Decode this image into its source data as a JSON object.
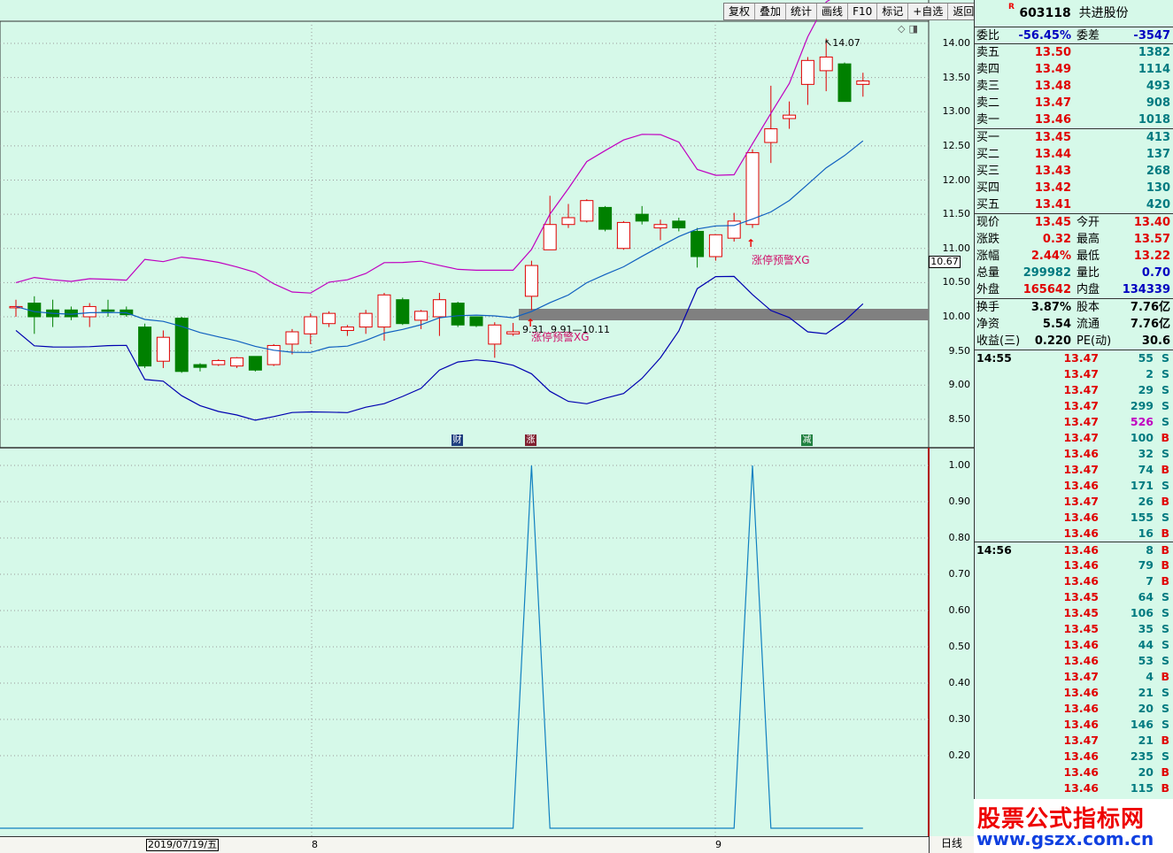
{
  "toolbar": [
    "复权",
    "叠加",
    "统计",
    "画线",
    "F10",
    "标记",
    "+自选",
    "返回"
  ],
  "chart": {
    "main_yticks": [
      "14.00",
      "13.50",
      "13.00",
      "12.50",
      "12.00",
      "11.50",
      "11.00",
      "10.50",
      "10.00",
      "9.50",
      "9.00",
      "8.50"
    ],
    "indicator_yticks": [
      "1.00",
      "0.90",
      "0.80",
      "0.70",
      "0.60",
      "0.50",
      "0.40",
      "0.30",
      "0.20"
    ],
    "current_price_tag": "10.67",
    "high_label": "14.07",
    "low_label": "9.31",
    "range_label": "9.91—10.11",
    "signal_label": "涨停预警XG",
    "event_marks": [
      {
        "text": "财",
        "color": "#204080"
      },
      {
        "text": "涨",
        "color": "#802030"
      },
      {
        "text": "减",
        "color": "#208040"
      }
    ],
    "dates": [
      "2019/07/19/五",
      "8",
      "9"
    ],
    "period": "日线",
    "candles": [
      {
        "o": 10.15,
        "h": 10.25,
        "l": 10.0,
        "c": 10.15
      },
      {
        "o": 10.2,
        "h": 10.3,
        "l": 9.75,
        "c": 10.0
      },
      {
        "o": 10.1,
        "h": 10.25,
        "l": 9.85,
        "c": 10.0
      },
      {
        "o": 10.1,
        "h": 10.15,
        "l": 9.95,
        "c": 10.0
      },
      {
        "o": 10.0,
        "h": 10.2,
        "l": 9.85,
        "c": 10.15
      },
      {
        "o": 10.1,
        "h": 10.25,
        "l": 10.0,
        "c": 10.08
      },
      {
        "o": 10.1,
        "h": 10.15,
        "l": 10.0,
        "c": 10.03
      },
      {
        "o": 9.85,
        "h": 9.9,
        "l": 9.25,
        "c": 9.28
      },
      {
        "o": 9.35,
        "h": 9.8,
        "l": 9.25,
        "c": 9.7
      },
      {
        "o": 9.98,
        "h": 10.0,
        "l": 9.18,
        "c": 9.2
      },
      {
        "o": 9.3,
        "h": 9.32,
        "l": 9.2,
        "c": 9.26
      },
      {
        "o": 9.3,
        "h": 9.38,
        "l": 9.28,
        "c": 9.36
      },
      {
        "o": 9.28,
        "h": 9.41,
        "l": 9.25,
        "c": 9.4
      },
      {
        "o": 9.42,
        "h": 9.42,
        "l": 9.2,
        "c": 9.22
      },
      {
        "o": 9.3,
        "h": 9.6,
        "l": 9.28,
        "c": 9.58
      },
      {
        "o": 9.6,
        "h": 9.82,
        "l": 9.45,
        "c": 9.78
      },
      {
        "o": 9.75,
        "h": 10.05,
        "l": 9.6,
        "c": 10.0
      },
      {
        "o": 9.9,
        "h": 10.08,
        "l": 9.85,
        "c": 10.05
      },
      {
        "o": 9.8,
        "h": 9.88,
        "l": 9.72,
        "c": 9.85
      },
      {
        "o": 9.85,
        "h": 10.1,
        "l": 9.75,
        "c": 10.05
      },
      {
        "o": 9.85,
        "h": 10.35,
        "l": 9.65,
        "c": 10.32
      },
      {
        "o": 10.25,
        "h": 10.28,
        "l": 9.88,
        "c": 9.9
      },
      {
        "o": 9.95,
        "h": 10.1,
        "l": 9.82,
        "c": 10.08
      },
      {
        "o": 10.0,
        "h": 10.35,
        "l": 9.72,
        "c": 10.25
      },
      {
        "o": 10.2,
        "h": 10.22,
        "l": 9.85,
        "c": 9.88
      },
      {
        "o": 10.0,
        "h": 10.0,
        "l": 9.85,
        "c": 9.87
      },
      {
        "o": 9.6,
        "h": 9.92,
        "l": 9.4,
        "c": 9.88
      },
      {
        "o": 9.75,
        "h": 9.91,
        "l": 9.72,
        "c": 9.78
      },
      {
        "o": 10.3,
        "h": 10.82,
        "l": 10.1,
        "c": 10.75
      },
      {
        "o": 10.98,
        "h": 11.77,
        "l": 10.98,
        "c": 11.35
      },
      {
        "o": 11.35,
        "h": 11.65,
        "l": 11.3,
        "c": 11.45
      },
      {
        "o": 11.4,
        "h": 11.72,
        "l": 11.38,
        "c": 11.7
      },
      {
        "o": 11.6,
        "h": 11.62,
        "l": 11.25,
        "c": 11.28
      },
      {
        "o": 11.0,
        "h": 11.4,
        "l": 10.98,
        "c": 11.38
      },
      {
        "o": 11.5,
        "h": 11.62,
        "l": 11.35,
        "c": 11.4
      },
      {
        "o": 11.3,
        "h": 11.42,
        "l": 11.12,
        "c": 11.35
      },
      {
        "o": 11.4,
        "h": 11.45,
        "l": 11.25,
        "c": 11.3
      },
      {
        "o": 11.25,
        "h": 11.3,
        "l": 10.72,
        "c": 10.88
      },
      {
        "o": 10.88,
        "h": 11.2,
        "l": 10.82,
        "c": 11.2
      },
      {
        "o": 11.15,
        "h": 11.52,
        "l": 11.1,
        "c": 11.4
      },
      {
        "o": 11.35,
        "h": 12.45,
        "l": 11.3,
        "c": 12.4
      },
      {
        "o": 12.55,
        "h": 13.38,
        "l": 12.25,
        "c": 12.75
      },
      {
        "o": 12.9,
        "h": 13.15,
        "l": 12.75,
        "c": 12.95
      },
      {
        "o": 13.4,
        "h": 13.8,
        "l": 13.1,
        "c": 13.75
      },
      {
        "o": 13.6,
        "h": 14.07,
        "l": 13.3,
        "c": 13.8
      },
      {
        "o": 13.7,
        "h": 13.72,
        "l": 13.15,
        "c": 13.15
      },
      {
        "o": 13.4,
        "h": 13.57,
        "l": 13.22,
        "c": 13.45
      }
    ]
  },
  "panel": {
    "code": "603118",
    "name": "共进股份",
    "r_mark": "R",
    "weibi": {
      "label": "委比",
      "value": "-56.45%",
      "label2": "委差",
      "value2": "-3547"
    },
    "sells": [
      {
        "label": "卖五",
        "price": "13.50",
        "vol": "1382"
      },
      {
        "label": "卖四",
        "price": "13.49",
        "vol": "1114"
      },
      {
        "label": "卖三",
        "price": "13.48",
        "vol": "493"
      },
      {
        "label": "卖二",
        "price": "13.47",
        "vol": "908"
      },
      {
        "label": "卖一",
        "price": "13.46",
        "vol": "1018"
      }
    ],
    "buys": [
      {
        "label": "买一",
        "price": "13.45",
        "vol": "413"
      },
      {
        "label": "买二",
        "price": "13.44",
        "vol": "137"
      },
      {
        "label": "买三",
        "price": "13.43",
        "vol": "268"
      },
      {
        "label": "买四",
        "price": "13.42",
        "vol": "130"
      },
      {
        "label": "买五",
        "price": "13.41",
        "vol": "420"
      }
    ],
    "quote": [
      {
        "l1": "现价",
        "v1": "13.45",
        "c1": "red",
        "l2": "今开",
        "v2": "13.40",
        "c2": "red"
      },
      {
        "l1": "涨跌",
        "v1": "0.32",
        "c1": "red",
        "l2": "最高",
        "v2": "13.57",
        "c2": "red"
      },
      {
        "l1": "涨幅",
        "v1": "2.44%",
        "c1": "red",
        "l2": "最低",
        "v2": "13.22",
        "c2": "red"
      },
      {
        "l1": "总量",
        "v1": "299982",
        "c1": "teal",
        "l2": "量比",
        "v2": "0.70",
        "c2": "blue"
      },
      {
        "l1": "外盘",
        "v1": "165642",
        "c1": "red",
        "l2": "内盘",
        "v2": "134339",
        "c2": "blue"
      }
    ],
    "fin": [
      {
        "l1": "换手",
        "v1": "3.87%",
        "l2": "股本",
        "v2": "7.76亿"
      },
      {
        "l1": "净资",
        "v1": "5.54",
        "l2": "流通",
        "v2": "7.76亿"
      },
      {
        "l1": "收益(三)",
        "v1": "0.220",
        "l2": "PE(动)",
        "v2": "30.6"
      }
    ],
    "ticks": [
      {
        "t": "14:55",
        "p": "13.47",
        "v": "55",
        "d": "S"
      },
      {
        "t": "",
        "p": "13.47",
        "v": "2",
        "d": "S"
      },
      {
        "t": "",
        "p": "13.47",
        "v": "29",
        "d": "S"
      },
      {
        "t": "",
        "p": "13.47",
        "v": "299",
        "d": "S"
      },
      {
        "t": "",
        "p": "13.47",
        "v": "526",
        "d": "S",
        "vc": "mag"
      },
      {
        "t": "",
        "p": "13.47",
        "v": "100",
        "d": "B"
      },
      {
        "t": "",
        "p": "13.46",
        "v": "32",
        "d": "S"
      },
      {
        "t": "",
        "p": "13.47",
        "v": "74",
        "d": "B"
      },
      {
        "t": "",
        "p": "13.46",
        "v": "171",
        "d": "S"
      },
      {
        "t": "",
        "p": "13.47",
        "v": "26",
        "d": "B"
      },
      {
        "t": "",
        "p": "13.46",
        "v": "155",
        "d": "S"
      },
      {
        "t": "",
        "p": "13.46",
        "v": "16",
        "d": "B"
      },
      {
        "t": "14:56",
        "p": "13.46",
        "v": "8",
        "d": "B"
      },
      {
        "t": "",
        "p": "13.46",
        "v": "79",
        "d": "B"
      },
      {
        "t": "",
        "p": "13.46",
        "v": "7",
        "d": "B"
      },
      {
        "t": "",
        "p": "13.45",
        "v": "64",
        "d": "S"
      },
      {
        "t": "",
        "p": "13.45",
        "v": "106",
        "d": "S"
      },
      {
        "t": "",
        "p": "13.45",
        "v": "35",
        "d": "S"
      },
      {
        "t": "",
        "p": "13.46",
        "v": "44",
        "d": "S"
      },
      {
        "t": "",
        "p": "13.46",
        "v": "53",
        "d": "S"
      },
      {
        "t": "",
        "p": "13.47",
        "v": "4",
        "d": "B"
      },
      {
        "t": "",
        "p": "13.46",
        "v": "21",
        "d": "S"
      },
      {
        "t": "",
        "p": "13.46",
        "v": "20",
        "d": "S"
      },
      {
        "t": "",
        "p": "13.46",
        "v": "146",
        "d": "S"
      },
      {
        "t": "",
        "p": "13.47",
        "v": "21",
        "d": "B"
      },
      {
        "t": "",
        "p": "13.46",
        "v": "235",
        "d": "S"
      },
      {
        "t": "",
        "p": "13.46",
        "v": "20",
        "d": "B"
      },
      {
        "t": "",
        "p": "13.46",
        "v": "115",
        "d": "B"
      }
    ]
  },
  "watermark": {
    "line1": "股票公式指标网",
    "line2": "www.gszx.com.cn"
  }
}
